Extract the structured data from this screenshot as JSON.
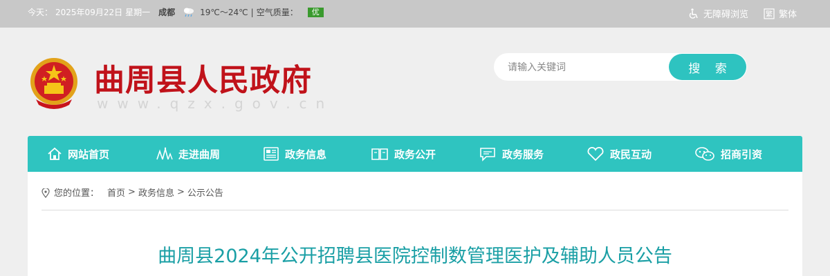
{
  "topbar": {
    "date_label": "今天：",
    "date": "2025年09月22日",
    "weekday": "星期一",
    "city": "成都",
    "temperature": "19℃～24℃",
    "air_quality_label": "空气质量：",
    "air_quality_value": "优",
    "accessibility_label": "无障碍浏览",
    "traditional_label": "繁体"
  },
  "header": {
    "site_title": "曲周县人民政府",
    "site_domain": "www.qzx.gov.cn",
    "search_placeholder": "请输入关键词",
    "search_button": "搜 索"
  },
  "nav": {
    "items": [
      {
        "label": "网站首页",
        "icon": "home-icon"
      },
      {
        "label": "走进曲周",
        "icon": "landmark-icon"
      },
      {
        "label": "政务信息",
        "icon": "newspaper-icon"
      },
      {
        "label": "政务公开",
        "icon": "open-book-icon"
      },
      {
        "label": "政务服务",
        "icon": "chat-icon"
      },
      {
        "label": "政民互动",
        "icon": "heart-icon"
      },
      {
        "label": "招商引资",
        "icon": "wechat-icon"
      }
    ]
  },
  "breadcrumb": {
    "label": "您的位置：",
    "items": [
      "首页",
      "政务信息",
      "公示公告"
    ],
    "separator": ">"
  },
  "article": {
    "title": "曲周县2024年公开招聘县医院控制数管理医护及辅助人员公告"
  },
  "colors": {
    "brand_red": "#c0121a",
    "accent_teal": "#2fc4c0",
    "title_teal": "#1a9fa5",
    "aq_good": "#3a9a2e"
  }
}
